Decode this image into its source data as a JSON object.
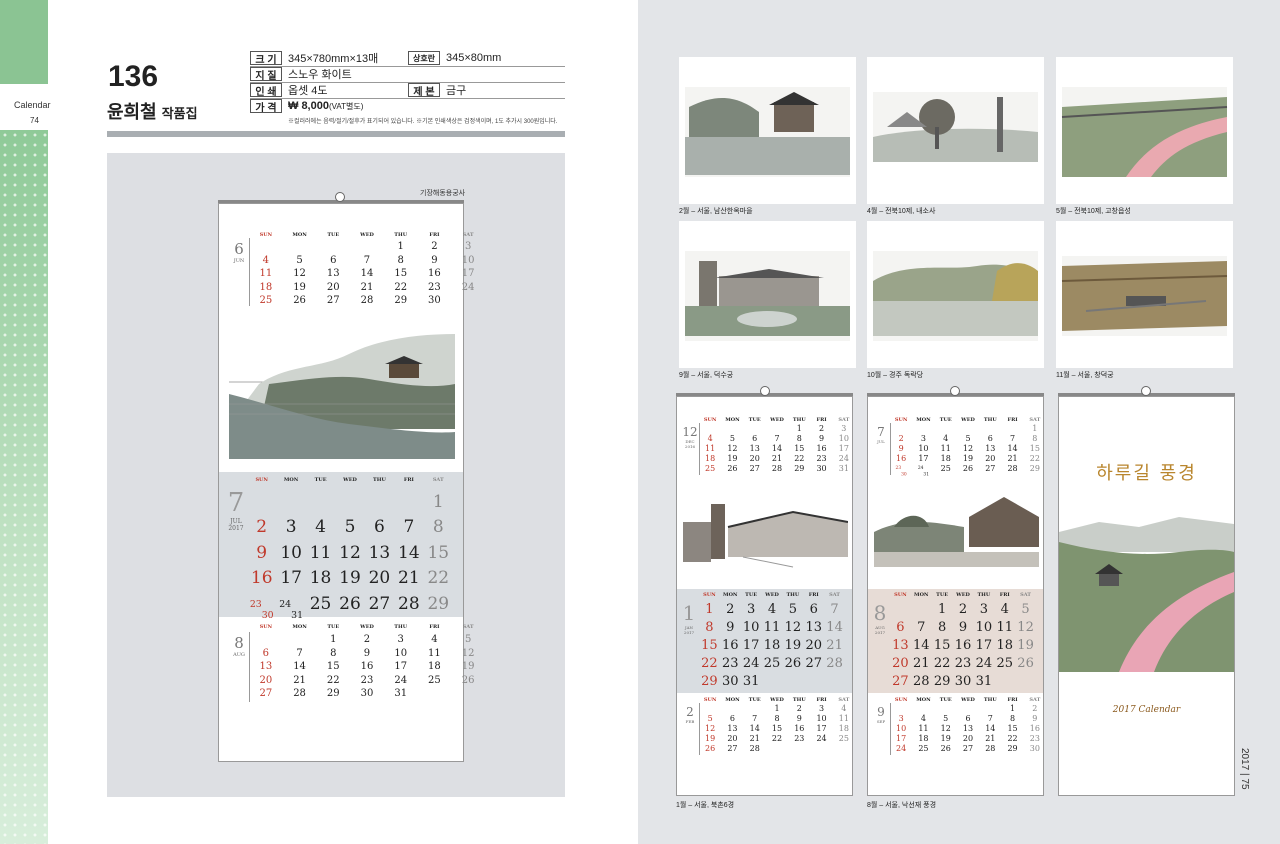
{
  "left_page": {
    "side_label": "Calendar",
    "page_number": "74",
    "product_number": "136",
    "product_title": "윤희철",
    "product_subtitle": "작품집",
    "specs": [
      {
        "key": "크 기",
        "value": "345×780mm×13매"
      },
      {
        "key": "지 질",
        "value": "스노우 화이트"
      },
      {
        "key": "인 쇄",
        "value": "옵셋 4도"
      },
      {
        "key": "가 격",
        "value": "₩ 8,000",
        "suffix": "(VAT별도)"
      }
    ],
    "specs_right": [
      {
        "key": "상호란",
        "value": "345×80mm"
      },
      {
        "key": "제 본",
        "value": "금구"
      }
    ],
    "note": "※컬러러에는 음력/절기/절후가 표기되어 있습니다.  ※기본 인쇄색상은 검정색이며, 1도 추가시 300원입니다.",
    "publisher": "기장해동용궁사"
  },
  "weekdays": [
    "SUN",
    "MON",
    "TUE",
    "WED",
    "THU",
    "FRI",
    "SAT"
  ],
  "calendar": {
    "jun": {
      "num": "6",
      "abbr": "JUN",
      "cells": [
        "",
        "",
        "",
        "",
        "1",
        "2",
        "3",
        "4",
        "5",
        "6",
        "7",
        "8",
        "9",
        "10",
        "11",
        "12",
        "13",
        "14",
        "15",
        "16",
        "17",
        "18",
        "19",
        "20",
        "21",
        "22",
        "23",
        "24",
        "25",
        "26",
        "27",
        "28",
        "29",
        "30",
        ""
      ]
    },
    "jul": {
      "num": "7",
      "abbr": "JUL",
      "year": "2017",
      "cells": [
        "",
        "",
        "",
        "",
        "",
        "",
        "1",
        "2",
        "3",
        "4",
        "5",
        "6",
        "7",
        "8",
        "9",
        "10",
        "11",
        "12",
        "13",
        "14",
        "15",
        "16",
        "17",
        "18",
        "19",
        "20",
        "21",
        "22",
        "23/30",
        "24/31",
        "25",
        "26",
        "27",
        "28",
        "29"
      ]
    },
    "aug": {
      "num": "8",
      "abbr": "AUG",
      "cells": [
        "",
        "",
        "1",
        "2",
        "3",
        "4",
        "5",
        "6",
        "7",
        "8",
        "9",
        "10",
        "11",
        "12",
        "13",
        "14",
        "15",
        "16",
        "17",
        "18",
        "19",
        "20",
        "21",
        "22",
        "23",
        "24",
        "25",
        "26",
        "27",
        "28",
        "29",
        "30",
        "31",
        "",
        ""
      ]
    }
  },
  "right_page": {
    "page_number": "2017 | 75",
    "photos": [
      {
        "caption": "2월 – 서울, 남산한옥마을"
      },
      {
        "caption": "4월 – 전북10제, 내소사"
      },
      {
        "caption": "5월 – 전북10제, 고창읍성"
      },
      {
        "caption": "9월 – 서울, 덕수궁"
      },
      {
        "caption": "10월 – 경주 독락당"
      },
      {
        "caption": "11월 – 서울, 창덕궁"
      }
    ],
    "calendar_captions": [
      "1월 – 서울, 북촌6경",
      "8월 – 서울, 낙선재 풍경"
    ],
    "cover_title": "하루길 풍경",
    "cover_subtitle": "2017 Calendar",
    "cal1": {
      "top": {
        "num": "12",
        "abbr": "DEC",
        "year": "2016",
        "cells": [
          "",
          "",
          "",
          "",
          "1",
          "2",
          "3",
          "4",
          "5",
          "6",
          "7",
          "8",
          "9",
          "10",
          "11",
          "12",
          "13",
          "14",
          "15",
          "16",
          "17",
          "18",
          "19",
          "20",
          "21",
          "22",
          "23",
          "24",
          "25",
          "26",
          "27",
          "28",
          "29",
          "30",
          "31"
        ]
      },
      "main": {
        "num": "1",
        "abbr": "JAN",
        "year": "2017",
        "cells": [
          "1",
          "2",
          "3",
          "4",
          "5",
          "6",
          "7",
          "8",
          "9",
          "10",
          "11",
          "12",
          "13",
          "14",
          "15",
          "16",
          "17",
          "18",
          "19",
          "20",
          "21",
          "22",
          "23",
          "24",
          "25",
          "26",
          "27",
          "28",
          "29",
          "30",
          "31",
          "",
          "",
          "",
          ""
        ]
      },
      "bottom": {
        "num": "2",
        "abbr": "FEB",
        "cells": [
          "",
          "",
          "",
          "1",
          "2",
          "3",
          "4",
          "5",
          "6",
          "7",
          "8",
          "9",
          "10",
          "11",
          "12",
          "13",
          "14",
          "15",
          "16",
          "17",
          "18",
          "19",
          "20",
          "21",
          "22",
          "23",
          "24",
          "25",
          "26",
          "27",
          "28",
          "",
          "",
          "",
          ""
        ]
      }
    },
    "cal2": {
      "top": {
        "num": "7",
        "abbr": "JUL",
        "cells": [
          "",
          "",
          "",
          "",
          "",
          "",
          "1",
          "2",
          "3",
          "4",
          "5",
          "6",
          "7",
          "8",
          "9",
          "10",
          "11",
          "12",
          "13",
          "14",
          "15",
          "16",
          "17",
          "18",
          "19",
          "20",
          "21",
          "22",
          "23/30",
          "24/31",
          "25",
          "26",
          "27",
          "28",
          "29"
        ]
      },
      "main": {
        "num": "8",
        "abbr": "AUG",
        "year": "2017",
        "cells": [
          "",
          "",
          "1",
          "2",
          "3",
          "4",
          "5",
          "6",
          "7",
          "8",
          "9",
          "10",
          "11",
          "12",
          "13",
          "14",
          "15",
          "16",
          "17",
          "18",
          "19",
          "20",
          "21",
          "22",
          "23",
          "24",
          "25",
          "26",
          "27",
          "28",
          "29",
          "30",
          "31",
          "",
          ""
        ]
      },
      "bottom": {
        "num": "9",
        "abbr": "SEP",
        "cells": [
          "",
          "",
          "",
          "",
          "",
          "1",
          "2",
          "3",
          "4",
          "5",
          "6",
          "7",
          "8",
          "9",
          "10",
          "11",
          "12",
          "13",
          "14",
          "15",
          "16",
          "17",
          "18",
          "19",
          "20",
          "21",
          "22",
          "23",
          "24",
          "25",
          "26",
          "27",
          "28",
          "29",
          "30"
        ]
      }
    }
  },
  "colors": {
    "accent_green": "#8bc493",
    "sunday_red": "#c0392b",
    "band_gray": "#d9dde1",
    "band_beige": "#e7dcd6"
  }
}
